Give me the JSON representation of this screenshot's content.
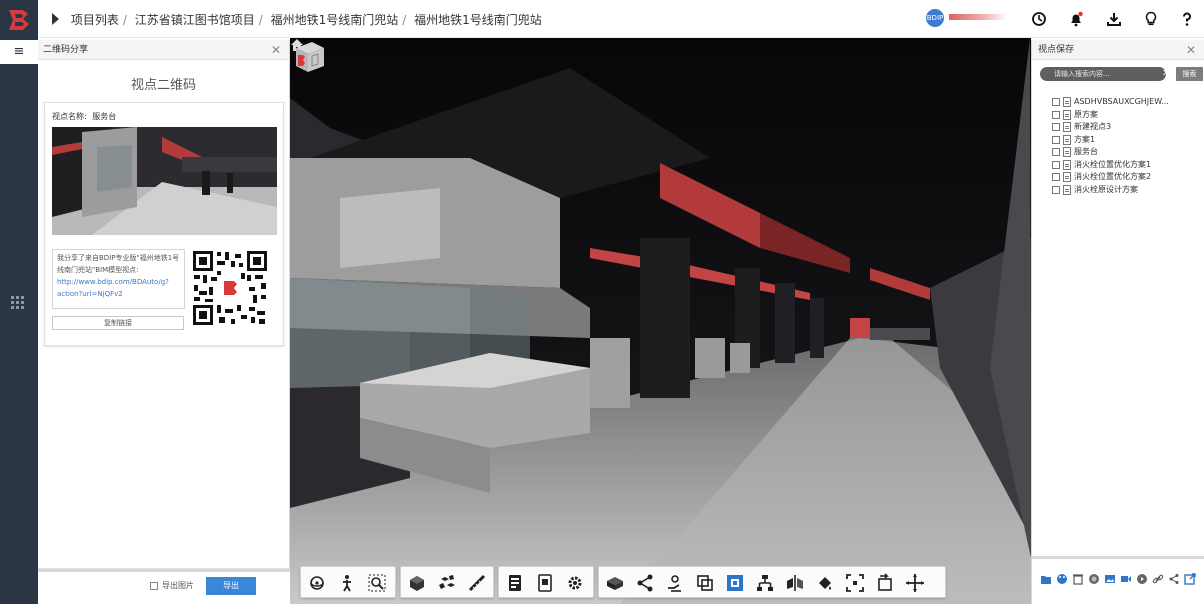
{
  "breadcrumb": {
    "items": [
      "项目列表",
      "江苏省镇江图书馆项目",
      "福州地铁1号线南门兜站",
      "福州地铁1号线南门兜站"
    ],
    "separator": "/"
  },
  "header": {
    "avatar_text": "BDIP",
    "icons": [
      "clock-icon",
      "bell-icon",
      "download-icon",
      "bulb-icon",
      "help-icon"
    ]
  },
  "qr_panel": {
    "header": "二维码分享",
    "title": "视点二维码",
    "viewpoint_label": "视点名称:",
    "viewpoint_name": "服务台",
    "share_text_1": "我分享了来自BDIP专业版\"福州地铁1号线南门兜站\"BIM模型视点:",
    "share_link": "http://www.bdip.com/BDAuto/g?action?url=NjQFv2",
    "copy_link": "复制链接",
    "export_checkbox_label": "导出图片",
    "export_button": "导出"
  },
  "viewpoint_save": {
    "header": "视点保存",
    "search_placeholder": "请输入搜索内容...",
    "search_button": "搜索",
    "items": [
      "ASDHVBSAUXCGHJEW...",
      "原方案",
      "新建视点3",
      "方案1",
      "服务台",
      "消火栓位置优化方案1",
      "消火栓位置优化方案2",
      "消火栓原设计方案"
    ]
  },
  "colors": {
    "rail": "#2b3645",
    "accent": "#3a87d8",
    "brand_red": "#d63a3a",
    "viewport_bg": "#0b0b0d"
  }
}
